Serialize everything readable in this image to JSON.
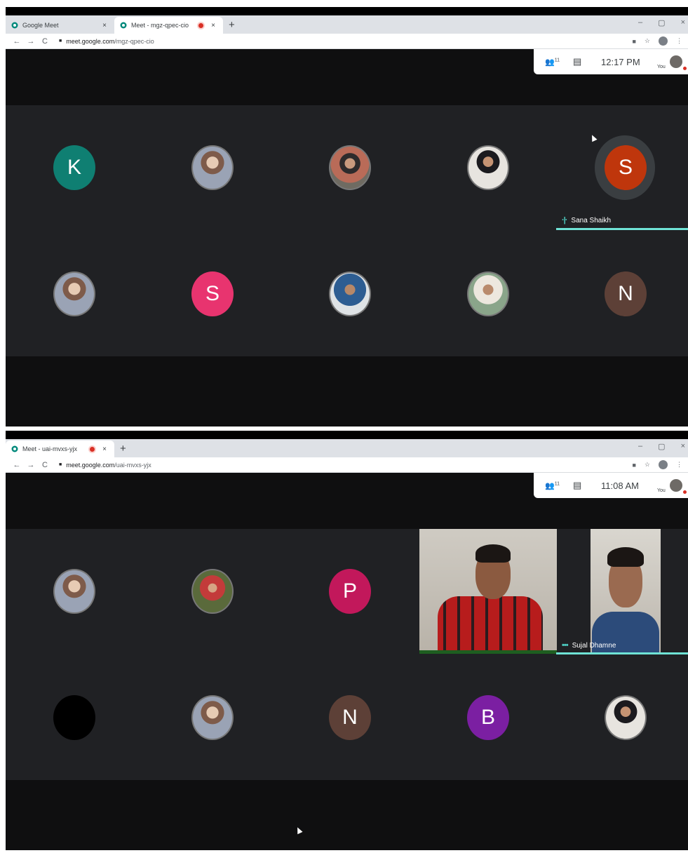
{
  "window1": {
    "tabs": [
      {
        "title": "Google Meet",
        "close": "×"
      },
      {
        "title": "Meet - mgz-qpec-cio",
        "close": "×"
      }
    ],
    "new_tab": "+",
    "controls": {
      "minimize": "–",
      "maximize": "▢",
      "close": "×"
    },
    "url_host": "meet.google.com",
    "url_path": "/mgz-qpec-cio",
    "topbar": {
      "people_count": "11",
      "time": "12:17 PM",
      "you_label": "You"
    },
    "tiles": [
      {
        "letter": "K",
        "color": "#0f7f72"
      },
      {
        "letter": "",
        "photo": true
      },
      {
        "letter": "",
        "photo": true
      },
      {
        "letter": "",
        "photo": true
      },
      {
        "letter": "S",
        "color": "#bf360c",
        "speaking": true
      },
      {
        "letter": "",
        "photo": true
      },
      {
        "letter": "S",
        "color": "#e8346f"
      },
      {
        "letter": "",
        "photo": true
      },
      {
        "letter": "",
        "photo": true
      },
      {
        "letter": "N",
        "color": "#5d4037"
      }
    ],
    "speaker_name": "Sana Shaikh"
  },
  "window2": {
    "tabs": [
      {
        "title": "Meet - uai-mvxs-yjx",
        "close": "×"
      }
    ],
    "new_tab": "+",
    "controls": {
      "minimize": "–",
      "maximize": "▢",
      "close": "×"
    },
    "url_host": "meet.google.com",
    "url_path": "/uai-mvxs-yjx",
    "topbar": {
      "people_count": "11",
      "time": "11:08 AM",
      "you_label": "You"
    },
    "tiles": [
      {
        "letter": "",
        "photo": true
      },
      {
        "letter": "",
        "photo": true
      },
      {
        "letter": "P",
        "color": "#c2185b"
      },
      {
        "letter": "",
        "photo": true,
        "color": "#000000"
      },
      {
        "letter": "",
        "photo": true
      },
      {
        "letter": "N",
        "color": "#5d4037"
      },
      {
        "letter": "B",
        "color": "#7b1fa2"
      },
      {
        "letter": "",
        "photo": true
      }
    ],
    "speaker_name": "Sujal Dhamne"
  },
  "colors": {
    "meet_bg": "#202124",
    "speaking_accent": "#6fe3d6",
    "video_bar": "#1e5e20"
  }
}
